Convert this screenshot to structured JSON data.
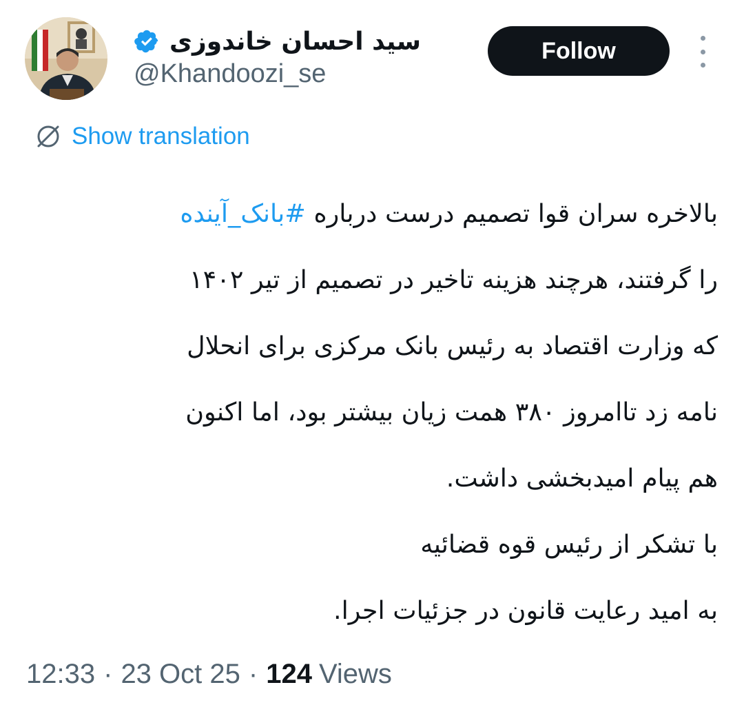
{
  "author": {
    "display_name": "سید احسان خاندوزی",
    "handle": "@Khandoozi_se",
    "verified": true,
    "avatar_icon": "profile-photo"
  },
  "actions": {
    "follow_label": "Follow",
    "more_icon": "more-vertical-icon"
  },
  "translation": {
    "icon": "translate-globe-icon",
    "label": "Show translation"
  },
  "tweet": {
    "line1_text": "بالاخره سران قوا تصمیم درست درباره ",
    "hashtag": "#بانک_آینده",
    "line2": "را گرفتند، هرچند هزینه تاخیر در تصمیم از تیر ۱۴۰۲",
    "line3": "که وزارت اقتصاد به رئیس بانک مرکزی برای انحلال",
    "line4": "نامه زد تاامروز ۳۸۰ همت زیان بیشتر بود، اما اکنون",
    "line5": "هم پیام امیدبخشی داشت.",
    "line6": "با تشکر از رئیس قوه قضائیه",
    "line7": "به امید رعایت قانون در جزئیات اجرا."
  },
  "meta": {
    "time": "12:33",
    "date": "23 Oct 25",
    "views_count": "124",
    "views_label": "Views"
  },
  "colors": {
    "text": "#0f1419",
    "secondary": "#536471",
    "link": "#1d9bf0",
    "follow_bg": "#0f1419"
  }
}
